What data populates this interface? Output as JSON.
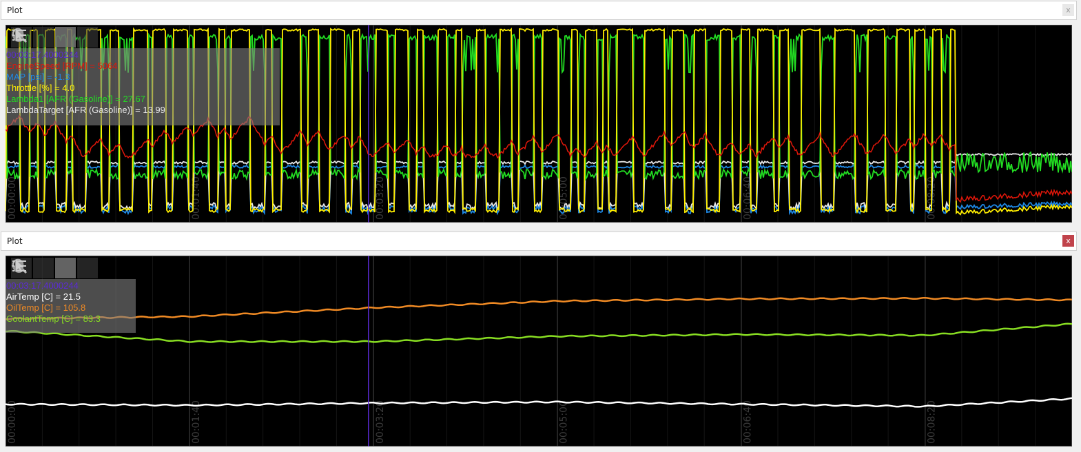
{
  "panels": [
    {
      "title": "Plot",
      "close_label": "x",
      "cursor_time": "00:03:17.4000244",
      "legend": [
        {
          "name": "EngineSpeed [RPM]",
          "value": "5064",
          "color": "#e3170a"
        },
        {
          "name": "MAP [psi]",
          "value": "-1.3",
          "color": "#1e88e5"
        },
        {
          "name": "Throttle [%]",
          "value": "4.0",
          "color": "#ffee00"
        },
        {
          "name": "Lambda1 [AFR (Gasoline)]",
          "value": "27.67",
          "color": "#22dd22"
        },
        {
          "name": "LambdaTarget [AFR (Gasoline)]",
          "value": "13.99",
          "color": "#e8e8e8"
        }
      ],
      "x_ticks": [
        "00:00:00",
        "00:01:40",
        "00:03:20",
        "00:05:00",
        "00:06:40",
        "00:08:20"
      ]
    },
    {
      "title": "Plot",
      "close_label": "x",
      "cursor_time": "00:03:17.4000244",
      "legend": [
        {
          "name": "AirTemp [C]",
          "value": "21.5",
          "color": "#ffffff"
        },
        {
          "name": "OilTemp [C]",
          "value": "105.8",
          "color": "#f08a24"
        },
        {
          "name": "CoolantTemp [C]",
          "value": "83.3",
          "color": "#88dd22"
        }
      ],
      "x_ticks": [
        "00:00:00",
        "00:01:40",
        "00:03:20",
        "00:05:00",
        "00:06:40",
        "00:08:20"
      ]
    }
  ],
  "toolbar_icons": [
    "zoom-icon",
    "pan-hand-icon",
    "pointer-icon",
    "list-icon"
  ],
  "cursor_color": "#5b2bd6",
  "chart_data": [
    {
      "type": "line",
      "x_unit": "time (hh:mm:ss)",
      "xlim": [
        "00:00:00",
        "00:09:40"
      ],
      "cursor_x": "00:03:17.4000244",
      "grid": true,
      "legend_position": "top-left",
      "series": [
        {
          "name": "EngineSpeed [RPM]",
          "color": "#e3170a",
          "pattern": "sawtooth",
          "cursor_value": 5064
        },
        {
          "name": "MAP [psi]",
          "color": "#1e88e5",
          "pattern": "pulses-low",
          "cursor_value": -1.3
        },
        {
          "name": "Throttle [%]",
          "color": "#ffee00",
          "pattern": "square-wave",
          "cursor_value": 4.0
        },
        {
          "name": "Lambda1 [AFR (Gasoline)]",
          "color": "#22dd22",
          "pattern": "square-wave-noisy",
          "cursor_value": 27.67
        },
        {
          "name": "LambdaTarget [AFR (Gasoline)]",
          "color": "#e8e8e8",
          "pattern": "pulses-low",
          "cursor_value": 13.99
        }
      ]
    },
    {
      "type": "line",
      "x_unit": "time (hh:mm:ss)",
      "xlim": [
        "00:00:00",
        "00:09:40"
      ],
      "cursor_x": "00:03:17.4000244",
      "grid": true,
      "legend_position": "top-left",
      "series": [
        {
          "name": "AirTemp [C]",
          "color": "#ffffff",
          "x": [
            "00:00:00",
            "00:01:40",
            "00:03:20",
            "00:05:00",
            "00:06:40",
            "00:08:20",
            "00:09:40"
          ],
          "values": [
            21.4,
            21.3,
            21.5,
            21.6,
            21.4,
            21.2,
            21.9
          ]
        },
        {
          "name": "OilTemp [C]",
          "color": "#f08a24",
          "x": [
            "00:00:00",
            "00:01:40",
            "00:03:20",
            "00:05:00",
            "00:06:40",
            "00:08:20",
            "00:09:40"
          ],
          "values": [
            103.8,
            104.2,
            105.8,
            107.0,
            107.4,
            107.5,
            107.2
          ]
        },
        {
          "name": "CoolantTemp [C]",
          "color": "#88dd22",
          "x": [
            "00:00:00",
            "00:01:40",
            "00:03:20",
            "00:05:00",
            "00:06:40",
            "00:08:20",
            "00:09:40"
          ],
          "values": [
            84.5,
            83.3,
            83.3,
            83.9,
            84.1,
            84.0,
            85.3
          ]
        }
      ]
    }
  ]
}
